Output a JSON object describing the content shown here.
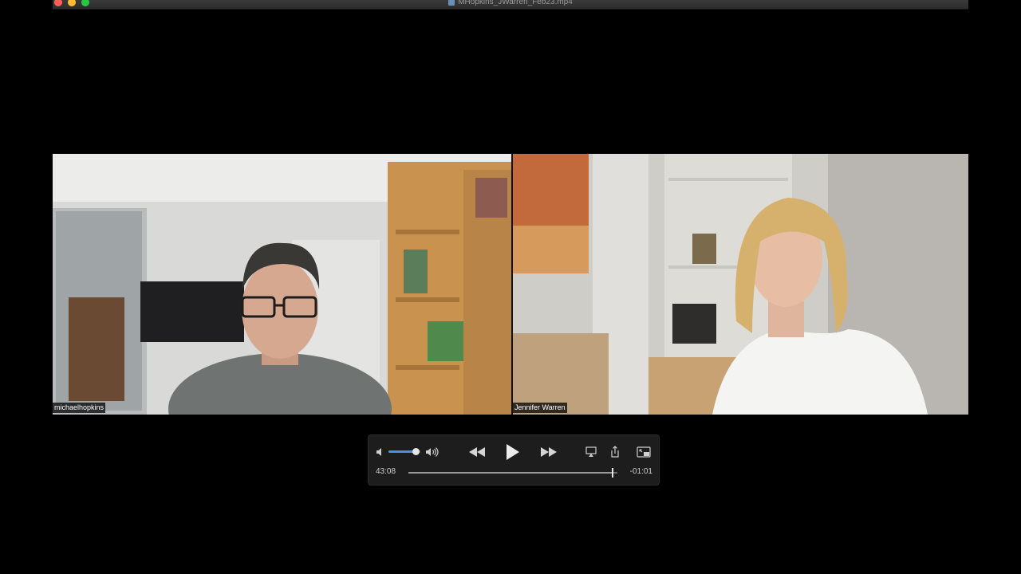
{
  "window": {
    "title": "MHopkins_JWarren_Feb23.mp4"
  },
  "participants": [
    {
      "name": "michaelhopkins"
    },
    {
      "name": "Jennifer Warren"
    }
  ],
  "player": {
    "elapsed": "43:08",
    "remaining": "-01:01",
    "progress": 0.977,
    "volume": 0.85,
    "icons": {
      "volume_low": "speaker-low-icon",
      "volume_high": "speaker-high-icon",
      "rewind": "rewind-icon",
      "play": "play-icon",
      "forward": "fast-forward-icon",
      "airplay": "airplay-icon",
      "share": "share-icon",
      "pip": "picture-in-picture-icon"
    }
  },
  "colors": {
    "accent": "#4a90e2",
    "close": "#ff5f57",
    "minimize": "#febc2e",
    "zoom": "#28c840"
  }
}
